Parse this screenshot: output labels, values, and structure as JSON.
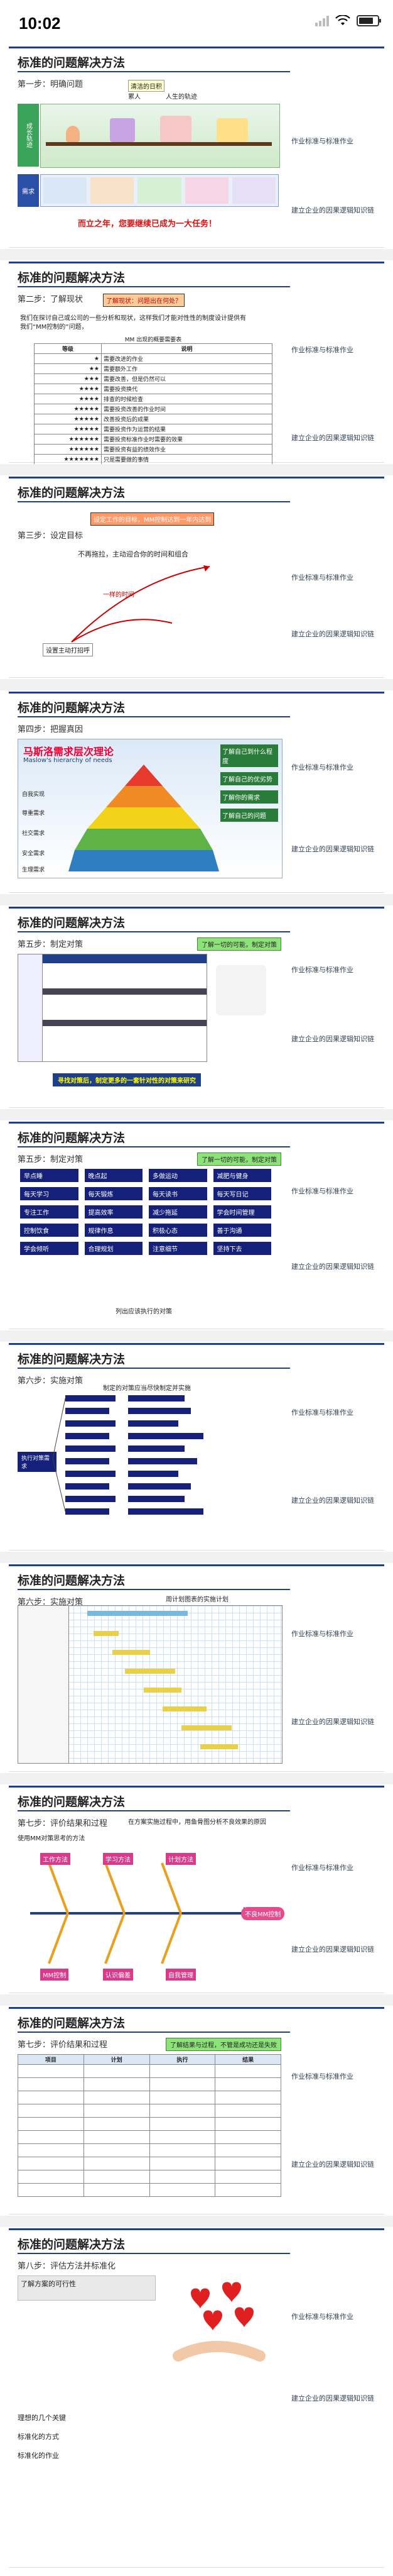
{
  "status_bar": {
    "time": "10:02"
  },
  "common": {
    "slide_title": "标准的问题解决方法",
    "side_note_a": "作业标准与标准作业",
    "side_note_b": "建立企业的因果逻辑知识链"
  },
  "slide1": {
    "step": "第一步：明确问题",
    "bubble_1": "清洁的日积",
    "bubble_2": "累人",
    "bubble_3": "人生的轨迹",
    "row_label_1": "成长轨迹",
    "row_label_2": "需求",
    "bottom_text": "而立之年，您要继续已成为一大任务！"
  },
  "slide2": {
    "step": "第二步：了解现状",
    "highlight": "了解现状：问题出在何处？",
    "intro_1": "我们在探讨自己或公司的一些分析和现状，这样我们才能对性性的制度设计提供有",
    "intro_2": "我们“MM控制的”问题，",
    "table_title": "MM 出现的概要需要表",
    "table_head": [
      "等级",
      "说明"
    ],
    "rows": [
      [
        "★",
        "需要改进的作业"
      ],
      [
        "★★",
        "需要额外工作"
      ],
      [
        "★★★",
        "需要改善，但是仍然可以"
      ],
      [
        "★★★★",
        "需要投资换代"
      ],
      [
        "★★★★",
        "排查的时候检查"
      ],
      [
        "★★★★★",
        "需要投资改善的作业时间"
      ],
      [
        "★★★★★",
        "改善投资后的成果"
      ],
      [
        "★★★★★",
        "需要投资作为运营的结果"
      ],
      [
        "★★★★★★",
        "需要投资标准作业时需要的效果"
      ],
      [
        "★★★★★★",
        "需要投资有益的绩效作业"
      ],
      [
        "★★★★★★★",
        "只是需要做的事情"
      ]
    ]
  },
  "slide3": {
    "step": "第三步：设定目标",
    "highlight": "设定工作的目标，MM控制达到一年内达到",
    "text_1": "不再拖拉，主动迎合你的时间和组合",
    "text_2": "一样的时间",
    "text_3": "设置主动打招呼"
  },
  "slide4": {
    "step": "第四步：把握真因",
    "banner": "马斯洛需求层次理论",
    "subtitle": "Maslow's hierarchy of needs",
    "levels": [
      "自我实现",
      "尊重需求",
      "社交需求",
      "安全需求",
      "生理需求"
    ],
    "right_boxes": [
      "了解自己到什么程度",
      "了解自己的优劣势",
      "了解你的需求",
      "了解自己的问题"
    ]
  },
  "slide5": {
    "step": "第五步：制定对策",
    "top_box": "了解一切的可能，制定对策",
    "bottom_text": "寻找对策后，制定更多的一套针对性的对策来研究"
  },
  "slide6": {
    "step": "第五步：制定对策",
    "top_box": "了解一切的可能，制定对策",
    "grid": [
      [
        "早点睡",
        "晚点起",
        "多做运动",
        "减肥与健身"
      ],
      [
        "每天学习",
        "每天锻炼",
        "每天读书",
        "每天写日记"
      ],
      [
        "专注工作",
        "提高效率",
        "减少拖延",
        "学会时间管理"
      ],
      [
        "控制饮食",
        "规律作息",
        "积极心态",
        "善于沟通"
      ],
      [
        "学会倾听",
        "合理规划",
        "注意细节",
        "坚持下去"
      ]
    ],
    "caption": "列出应该执行的对策"
  },
  "slide7": {
    "step": "第六步：实施对策",
    "top_text": "制定的对策应当尽快制定并实施",
    "left_box": "执行对策需求"
  },
  "slide8": {
    "step": "第六步：实施对策",
    "chart_title": "周计划图表的实施计划"
  },
  "slide9": {
    "step": "第七步：评价结果和过程",
    "desc": "在方案实施过程中，用鱼骨图分析不良效果的原因",
    "goal": "使用MM对策思考的方法",
    "head": "不良MM控制",
    "labels": [
      "工作方法",
      "学习方法",
      "计划方法",
      "MM控制",
      "认识偏差",
      "自我管理"
    ]
  },
  "slide10": {
    "step": "第七步：评价结果和过程",
    "bubble": "了解结果与过程，不管是成功还是失败",
    "table_head": [
      "项目",
      "计划",
      "执行",
      "结果"
    ]
  },
  "slide11": {
    "step": "第八步：评估方法并标准化",
    "box": "了解方案的可行性",
    "text_1": "理想的几个关键",
    "text_2": "标准化的方式",
    "text_3": "标准化的作业"
  }
}
